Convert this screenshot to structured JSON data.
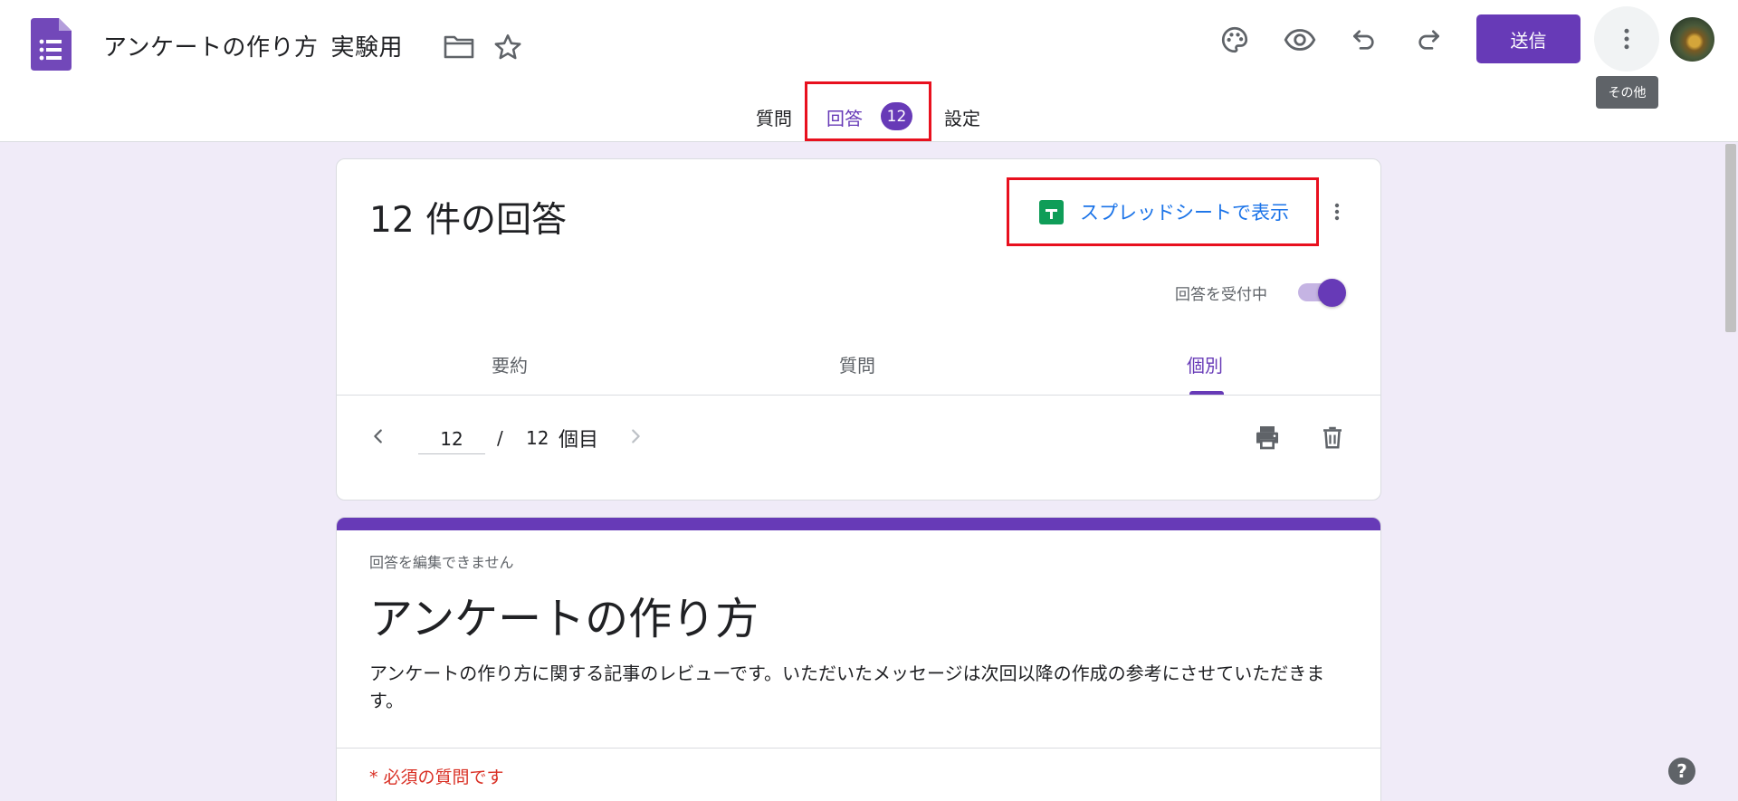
{
  "header": {
    "doc_title": "アンケートの作り方",
    "doc_subtitle": "実験用",
    "send_label": "送信",
    "more_tooltip": "その他",
    "icons": [
      "forms-logo-icon",
      "folder-icon",
      "star-icon",
      "palette-icon",
      "preview-icon",
      "undo-icon",
      "redo-icon",
      "more-vert-icon"
    ],
    "brand_color": "#673ab7"
  },
  "tabs": {
    "questions": "質問",
    "responses": "回答",
    "responses_badge": "12",
    "settings": "設定"
  },
  "summary": {
    "count_title": "12 件の回答",
    "sheets_link": "スプレッドシートで表示",
    "accepting_label": "回答を受付中",
    "accepting_on": true,
    "subtabs": [
      "要約",
      "質問",
      "個別"
    ],
    "active_subtab": "個別",
    "pager": {
      "current": "12",
      "slash": "/",
      "total": "12",
      "unit": "個目"
    }
  },
  "form": {
    "cannot_edit": "回答を編集できません",
    "title": "アンケートの作り方",
    "description": "アンケートの作り方に関する記事のレビューです。いただいたメッセージは次回以降の作成の参考にさせていただきます。",
    "required_note": "* 必須の質問です"
  },
  "help_label": "?"
}
